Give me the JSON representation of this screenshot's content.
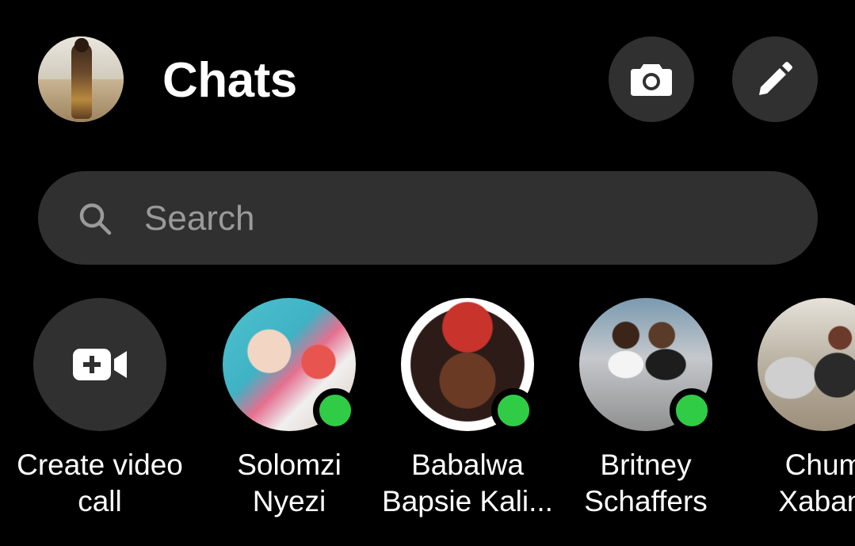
{
  "header": {
    "title": "Chats",
    "camera_icon": "camera-icon",
    "compose_icon": "pencil-icon"
  },
  "search": {
    "placeholder": "Search",
    "icon": "search-icon"
  },
  "colors": {
    "background": "#000000",
    "surface": "#303030",
    "online": "#31cc46",
    "placeholder": "#9a9a9a"
  },
  "contacts": {
    "create_call": {
      "label": "Create video\ncall",
      "icon": "video-camera-plus-icon"
    },
    "items": [
      {
        "name": "Solomzi\nNyezi",
        "online": true
      },
      {
        "name": "Babalwa\nBapsie Kali...",
        "online": true
      },
      {
        "name": "Britney\nSchaffers",
        "online": true
      },
      {
        "name": "Chum\nXabani",
        "online": false
      }
    ]
  }
}
